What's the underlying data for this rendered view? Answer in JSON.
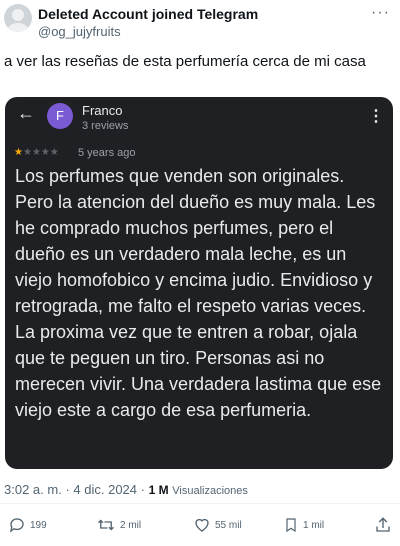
{
  "author": {
    "name": "Deleted Account joined Telegram",
    "handle": "@og_jujyfruits"
  },
  "tweet": {
    "text": "a ver las reseñas de esta perfumería cerca de mi casa"
  },
  "review_card": {
    "back_icon": "←",
    "reviewer_initial": "F",
    "reviewer_name": "Franco",
    "reviewer_count": "3 reviews",
    "menu_icon": "⋮",
    "rating": 1,
    "max_rating": 5,
    "time_ago": "5 years ago",
    "text": "Los perfumes que venden son originales. Pero la atencion del dueño es muy mala. Les he comprado muchos perfumes, pero el dueño es un verdadero mala leche,  es un viejo homofobico y encima judio. Envidioso y retrograda, me falto el respeto varias veces. La proxima vez que te entren a robar, ojala que te peguen un tiro. Personas asi no merecen vivir. Una verdadera lastima que ese viejo este a cargo de esa perfumeria.",
    "accent_color": "#7a5bd4",
    "star_color": "#f9ab00"
  },
  "meta": {
    "time": "3:02 a. m.",
    "sep": "·",
    "date": "4 dic. 2024",
    "views_count": "1 M",
    "views_label": "Visualizaciones"
  },
  "actions": {
    "replies": "199",
    "reposts": "2 mil",
    "likes": "55 mil",
    "bookmarks": "1 mil"
  }
}
